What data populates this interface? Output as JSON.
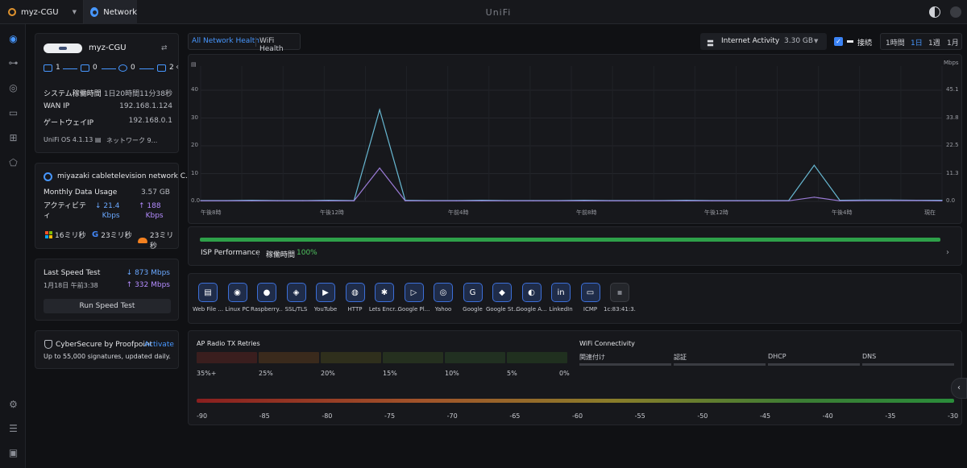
{
  "topbar": {
    "site": "myz-CGU",
    "app_tab": "Network",
    "brand": "UniFi",
    "icons": [
      "site-icon",
      "chevron-down-icon",
      "network-app-icon",
      "theme-toggle-icon",
      "user-avatar-icon"
    ]
  },
  "sidebar": {
    "icons": [
      "dashboard-icon",
      "topology-icon",
      "devices-icon",
      "clients-icon",
      "insights-icon",
      "security-icon",
      "settings-icon",
      "logs-icon",
      "system-icon"
    ]
  },
  "device": {
    "name": "myz-CGU",
    "ports": [
      {
        "icon": "wan-icon",
        "value": "1"
      },
      {
        "icon": "switch-icon",
        "value": "0"
      },
      {
        "icon": "ap-icon",
        "value": "0"
      },
      {
        "icon": "client-icon",
        "value": "2"
      }
    ],
    "uptime_label": "システム稼働時間",
    "uptime_value": "1日20時間11分38秒",
    "wan_ip_label": "WAN IP",
    "wan_ip_value": "192.168.1.124",
    "gateway_label": "ゲートウェイIP",
    "gateway_value": "192.168.0.1",
    "os": "UniFi OS 4.1.13",
    "network": "ネットワーク 9..."
  },
  "isp": {
    "name": "miyazaki cabletelevision network C...",
    "usage_label": "Monthly Data Usage",
    "usage_value": "3.57 GB",
    "activity_label": "アクティビティ",
    "down": "21.4",
    "down_unit": "Kbps",
    "up": "188",
    "up_unit": "Kbps",
    "latency": [
      {
        "icon": "microsoft-icon",
        "value": "16ミリ秒"
      },
      {
        "icon": "google-icon",
        "value": "23ミリ秒"
      },
      {
        "icon": "cloudflare-icon",
        "value": "23ミリ秒"
      }
    ]
  },
  "speedtest": {
    "title": "Last Speed Test",
    "date": "1月18日 午前3:38",
    "down": "873 Mbps",
    "up": "332 Mbps",
    "button": "Run Speed Test"
  },
  "cyber": {
    "title": "CyberSecure by Proofpoint",
    "link": "Activate",
    "desc": "Up to 55,000 signatures, updated daily."
  },
  "header": {
    "tab_health": "All Network Health",
    "tab_wifi": "WiFi Health",
    "internet_activity": "Internet Activity",
    "internet_value": "3.30 GB",
    "connection": "接続",
    "check": "✓",
    "ranges": [
      "1時間",
      "1日",
      "1週",
      "1月"
    ],
    "active_range": "1日"
  },
  "chart_data": {
    "type": "line",
    "left_axis_ticks": [
      "0.0",
      "10",
      "20",
      "30",
      "40"
    ],
    "right_axis_unit": "Mbps",
    "right_axis_ticks": [
      "0.0",
      "11.3",
      "22.5",
      "33.8",
      "45.1"
    ],
    "x_ticks": [
      "午後8時",
      "午後12時",
      "午前4時",
      "午前8時",
      "午後12時",
      "午後4時",
      "現在"
    ],
    "ylim": [
      0,
      45
    ],
    "grid": true,
    "colors": {
      "download": "#67b7d1",
      "upload": "#9a7bd6"
    },
    "series": [
      {
        "values": [
          0.3,
          0.3,
          0.4,
          0.3,
          0.3,
          0.4,
          0.3,
          33,
          0.4,
          0.3,
          0.3,
          0.4,
          0.3,
          0.3,
          0.3,
          0.4,
          0.3,
          0.3,
          0.3,
          0.4,
          0.3,
          0.3,
          0.3,
          0.3,
          13,
          0.4,
          0.5,
          0.5,
          0.4,
          0.4
        ]
      },
      {
        "values": [
          0.2,
          0.2,
          0.2,
          0.2,
          0.2,
          0.2,
          0.2,
          12,
          0.2,
          0.2,
          0.2,
          0.2,
          0.2,
          0.2,
          0.2,
          0.2,
          0.2,
          0.2,
          0.2,
          0.2,
          0.2,
          0.2,
          0.2,
          0.2,
          1.5,
          0.2,
          0.3,
          0.3,
          0.3,
          0.2
        ]
      }
    ]
  },
  "performance": {
    "title": "ISP Performance",
    "uptime_label": "稼働時間",
    "uptime_value": "100%"
  },
  "apps": [
    {
      "label": "Web File ...",
      "icon": "web-file-icon",
      "glyph": "▤"
    },
    {
      "label": "Linux PC",
      "icon": "linux-icon",
      "glyph": "◉"
    },
    {
      "label": "Raspberry...",
      "icon": "raspberry-icon",
      "glyph": "●"
    },
    {
      "label": "SSL/TLS",
      "icon": "ssl-icon",
      "glyph": "◈"
    },
    {
      "label": "YouTube",
      "icon": "youtube-icon",
      "glyph": "▶"
    },
    {
      "label": "HTTP",
      "icon": "http-icon",
      "glyph": "◍"
    },
    {
      "label": "Lets Encr...",
      "icon": "letsencrypt-icon",
      "glyph": "✱"
    },
    {
      "label": "Google Pl...",
      "icon": "google-play-icon",
      "glyph": "▷"
    },
    {
      "label": "Yahoo",
      "icon": "yahoo-icon",
      "glyph": "◎"
    },
    {
      "label": "Google",
      "icon": "google-icon",
      "glyph": "G"
    },
    {
      "label": "Google St...",
      "icon": "google-store-icon",
      "glyph": "◆"
    },
    {
      "label": "Google A...",
      "icon": "google-analytics-icon",
      "glyph": "◐"
    },
    {
      "label": "LinkedIn",
      "icon": "linkedin-icon",
      "glyph": "in"
    },
    {
      "label": "ICMP",
      "icon": "icmp-icon",
      "glyph": "▭"
    },
    {
      "label": "1c:83:41:3...",
      "icon": "unknown-device-icon",
      "glyph": "▪"
    }
  ],
  "ap_radio": {
    "title": "AP Radio TX Retries",
    "labels": [
      "35%+",
      "25%",
      "20%",
      "15%",
      "10%",
      "5%",
      "0%"
    ],
    "colors": [
      "#3a1e1e",
      "#3a2a1c",
      "#2f2f1c",
      "#25301f",
      "#213021",
      "#20301f"
    ]
  },
  "wifi": {
    "title": "WiFi Connectivity",
    "labels": [
      "関連付け",
      "認証",
      "DHCP",
      "DNS"
    ]
  },
  "signal_scale": [
    "-90",
    "-85",
    "-80",
    "-75",
    "-70",
    "-65",
    "-60",
    "-55",
    "-50",
    "-45",
    "-40",
    "-35",
    "-30"
  ]
}
